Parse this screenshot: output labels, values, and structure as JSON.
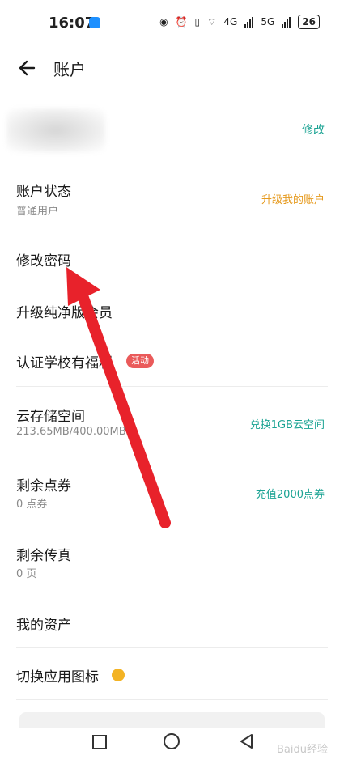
{
  "status": {
    "time": "16:07",
    "net1": "4G",
    "net2": "5G",
    "battery": "26"
  },
  "header": {
    "title": "账户"
  },
  "profile": {
    "edit_label": "修改"
  },
  "rows": {
    "account_status": {
      "title": "账户状态",
      "sub": "普通用户",
      "action": "升级我的账户"
    },
    "change_password": {
      "title": "修改密码"
    },
    "upgrade_pure": {
      "title": "升级纯净版会员"
    },
    "school": {
      "title": "认证学校有福利",
      "badge": "活动"
    },
    "cloud": {
      "title": "云存储空间",
      "sub": "213.65MB/400.00MB",
      "action": "兑换1GB云空间"
    },
    "points": {
      "title": "剩余点券",
      "sub": "0 点券",
      "action": "充值2000点券"
    },
    "fax": {
      "title": "剩余传真",
      "sub": "0 页"
    },
    "assets": {
      "title": "我的资产"
    },
    "app_icon": {
      "title": "切换应用图标"
    }
  },
  "watermark": "Baidu经验",
  "colors": {
    "accent": "#1aa393",
    "upgrade": "#e69a1e",
    "badge": "#ea5a5a",
    "arrow": "#e8222b"
  }
}
